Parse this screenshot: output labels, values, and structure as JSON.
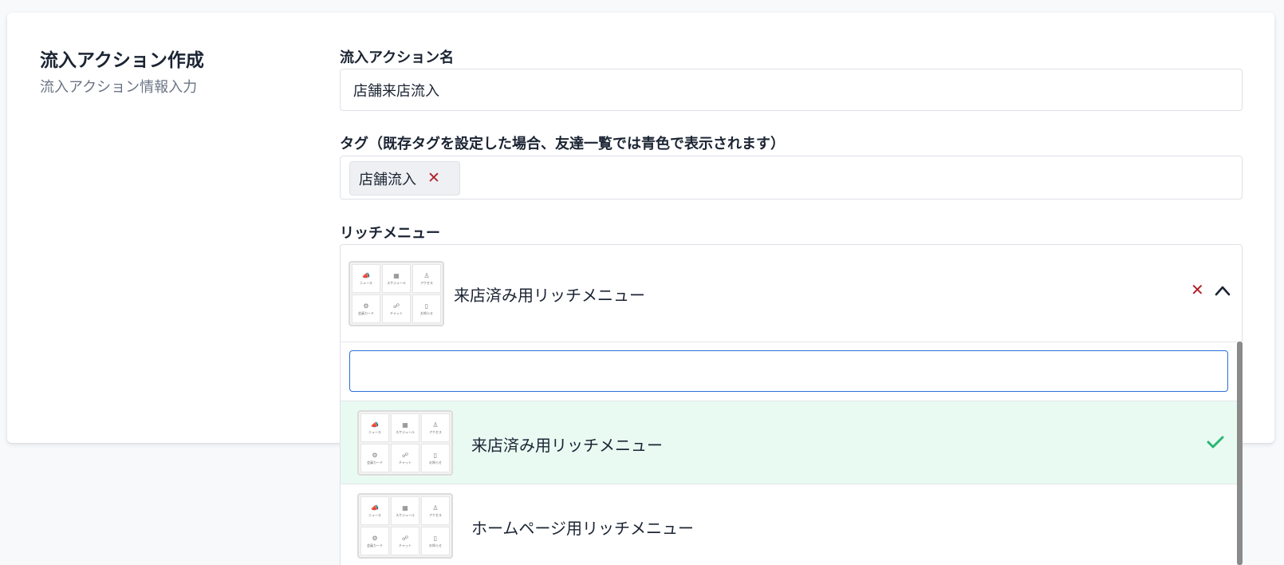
{
  "section": {
    "title": "流入アクション作成",
    "subtitle": "流入アクション情報入力"
  },
  "fields": {
    "action_name": {
      "label": "流入アクション名",
      "value": "店舗来店流入"
    },
    "tags": {
      "label": "タグ（既存タグを設定した場合、友達一覧では青色で表示されます）",
      "items": [
        {
          "label": "店舗流入",
          "remove_icon": "x-icon"
        }
      ]
    },
    "rich_menu": {
      "label": "リッチメニュー",
      "selected_value": "来店済み用リッチメニュー",
      "clear_icon": "x-icon",
      "toggle_icon": "chevron-up-icon",
      "search_value": "",
      "options": [
        {
          "label": "来店済み用リッチメニュー",
          "selected": true,
          "check_icon": "check-icon"
        },
        {
          "label": "ホームページ用リッチメニュー",
          "selected": false
        }
      ]
    }
  },
  "thumbnail_cells": [
    {
      "glyph": "📣",
      "text": "ニュース"
    },
    {
      "glyph": "▦",
      "text": "スケジュール"
    },
    {
      "glyph": "♙",
      "text": "アクセス"
    },
    {
      "glyph": "⚙",
      "text": "会員カード"
    },
    {
      "glyph": "☍",
      "text": "チャット"
    },
    {
      "glyph": "▯",
      "text": "お知らせ"
    }
  ],
  "colors": {
    "accent_blue": "#2a6fd6",
    "danger_red": "#b3202a",
    "success_green": "#2bb673",
    "selected_bg": "#e9faf2"
  }
}
